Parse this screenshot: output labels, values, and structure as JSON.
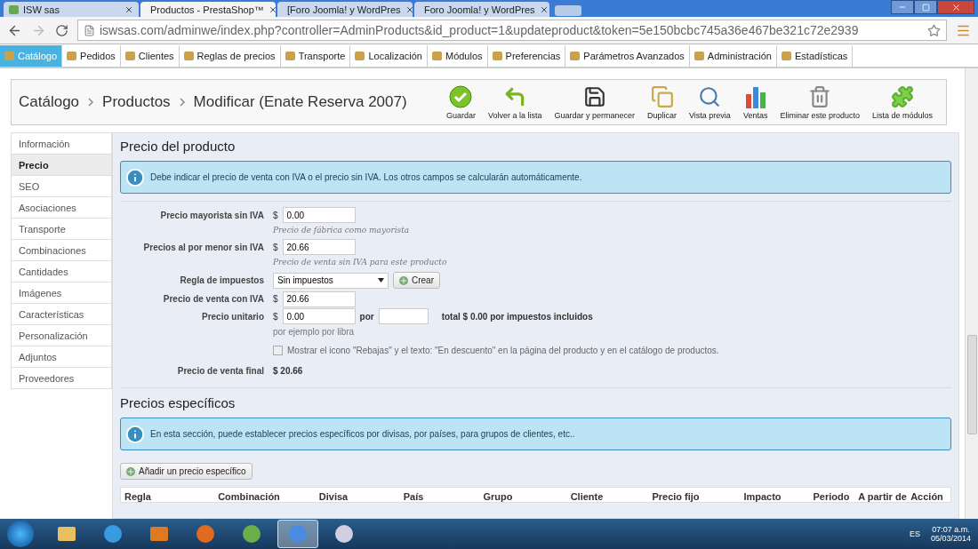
{
  "browser": {
    "tabs": [
      {
        "title": "ISW sas",
        "selected": false,
        "kind": "shop"
      },
      {
        "title": "Productos - PrestaShop™",
        "selected": true,
        "kind": "shop"
      },
      {
        "title": "[Foro Joomla! y WordPres",
        "selected": false,
        "kind": "mail"
      },
      {
        "title": "Foro Joomla! y WordPres",
        "selected": false,
        "kind": "forum"
      }
    ],
    "url": "iswsas.com/adminwe/index.php?controller=AdminProducts&id_product=1&updateproduct&token=5e150bcbc745a36e467be321c72e2939"
  },
  "admin_menu": [
    {
      "label": "Catálogo",
      "selected": true
    },
    {
      "label": "Pedidos",
      "selected": false
    },
    {
      "label": "Clientes",
      "selected": false
    },
    {
      "label": "Reglas de precios",
      "selected": false
    },
    {
      "label": "Transporte",
      "selected": false
    },
    {
      "label": "Localización",
      "selected": false
    },
    {
      "label": "Módulos",
      "selected": false
    },
    {
      "label": "Preferencias",
      "selected": false
    },
    {
      "label": "Parámetros Avanzados",
      "selected": false
    },
    {
      "label": "Administración",
      "selected": false
    },
    {
      "label": "Estadísticas",
      "selected": false
    }
  ],
  "breadcrumb": [
    "Catálogo",
    "Productos",
    "Modificar (Enate Reserva 2007)"
  ],
  "toolbar": [
    {
      "label": "Guardar",
      "kind": "save"
    },
    {
      "label": "Volver a la lista",
      "kind": "back"
    },
    {
      "label": "Guardar y permanecer",
      "kind": "disk"
    },
    {
      "label": "Duplicar",
      "kind": "duplicate"
    },
    {
      "label": "Vista previa",
      "kind": "preview"
    },
    {
      "label": "Ventas",
      "kind": "sales"
    },
    {
      "label": "Eliminar este producto",
      "kind": "delete"
    },
    {
      "label": "Lista de módulos",
      "kind": "modules"
    }
  ],
  "sidebar": [
    {
      "label": "Información",
      "selected": false
    },
    {
      "label": "Precio",
      "selected": true
    },
    {
      "label": "SEO",
      "selected": false
    },
    {
      "label": "Asociaciones",
      "selected": false
    },
    {
      "label": "Transporte",
      "selected": false
    },
    {
      "label": "Combinaciones",
      "selected": false
    },
    {
      "label": "Cantidades",
      "selected": false
    },
    {
      "label": "Imágenes",
      "selected": false
    },
    {
      "label": "Características",
      "selected": false
    },
    {
      "label": "Personalización",
      "selected": false
    },
    {
      "label": "Adjuntos",
      "selected": false
    },
    {
      "label": "Proveedores",
      "selected": false
    }
  ],
  "price_section": {
    "title": "Precio del producto",
    "info": "Debe indicar el precio de venta con IVA o el precio sin IVA. Los otros campos se calcularán automáticamente.",
    "fields": [
      {
        "kind": "money",
        "label": "Precio mayorista sin IVA",
        "currency": "$",
        "value": "0.00",
        "hint": "Precio de fábrica como mayorista"
      },
      {
        "kind": "money",
        "label": "Precios al por menor sin IVA",
        "currency": "$",
        "value": "20.66",
        "hint": "Precio de venta sin IVA para este producto"
      },
      {
        "kind": "select",
        "label": "Regla de impuestos",
        "value": "Sin impuestos",
        "button": "Crear"
      },
      {
        "kind": "money",
        "label": "Precio de venta con IVA",
        "currency": "$",
        "value": "20.66"
      },
      {
        "kind": "unit",
        "label": "Precio unitario",
        "currency": "$",
        "value": "0.00",
        "per_label": "por",
        "total": "total $ 0.00 por impuestos incluidos",
        "hint": "por ejemplo por libra"
      },
      {
        "kind": "checkbox",
        "label": "Mostrar el icono \"Rebajas\" y el texto: \"En descuento\" en la página del producto y en el catálogo de productos.",
        "checked": false
      },
      {
        "kind": "final",
        "label": "Precio de venta final",
        "value": "$ 20.66"
      }
    ]
  },
  "specific_section": {
    "title": "Precios específicos",
    "info": "En esta sección, puede establecer precios específicos por divisas, por países, para grupos de clientes, etc..",
    "add_button": "Añadir un precio específico",
    "columns": [
      "Regla",
      "Combinación",
      "Divisa",
      "País",
      "Grupo",
      "Cliente",
      "Precio fijo",
      "Impacto",
      "Periodo",
      "A partir de",
      "Acción"
    ]
  },
  "taskbar": {
    "apps": [
      {
        "kind": "folder",
        "selected": false
      },
      {
        "kind": "ie",
        "selected": false
      },
      {
        "kind": "media",
        "selected": false
      },
      {
        "kind": "firefox",
        "selected": false
      },
      {
        "kind": "messenger",
        "selected": false
      },
      {
        "kind": "chrome",
        "selected": true
      },
      {
        "kind": "paint",
        "selected": false
      }
    ],
    "language": "ES",
    "time": "07:07 a.m.",
    "date": "05/03/2014"
  }
}
